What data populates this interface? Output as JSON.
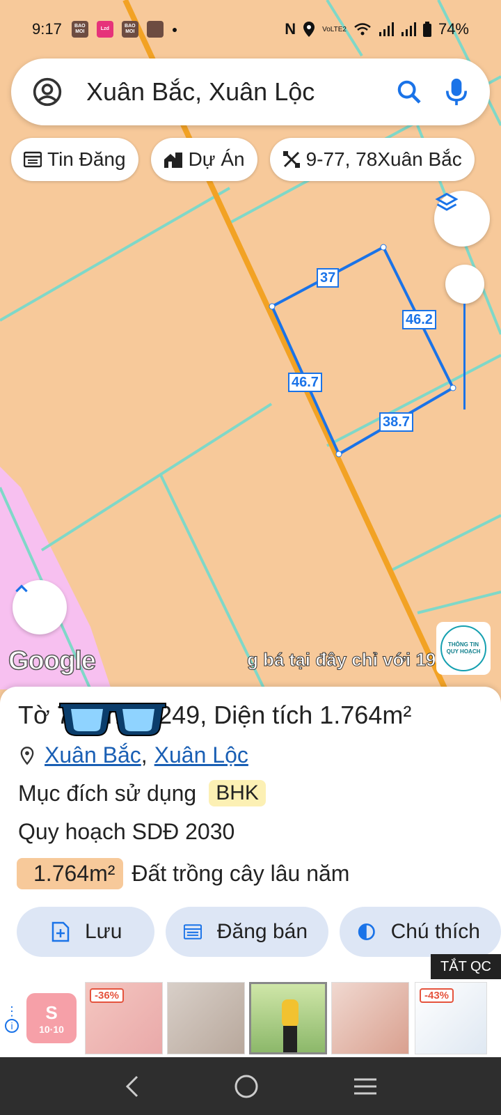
{
  "status_bar": {
    "time": "9:17",
    "apps": [
      "BAO MOI",
      "Lzd",
      "BAO MOI",
      "bag"
    ],
    "network_label": "VoLTE2",
    "battery": "74%"
  },
  "search": {
    "query": "Xuân Bắc, Xuân Lộc"
  },
  "chips": [
    {
      "label": "Tin Đăng",
      "icon": "listing-icon"
    },
    {
      "label": "Dự Án",
      "icon": "building-icon"
    },
    {
      "label": "9-77, 78Xuân Bắc",
      "icon": "parcel-icon"
    }
  ],
  "map": {
    "dimensions": {
      "top": "37",
      "right": "46.2",
      "left": "46.7",
      "bottom": "38.7"
    },
    "attribution": "Google",
    "ticker": "g bá tại đây chỉ với 19k",
    "info_badge": {
      "line1": "THÔNG TIN",
      "line2": "QUY HOẠCH"
    }
  },
  "parcel": {
    "title": "Tờ 79 Thửa 249, Diện tích 1.764m²",
    "location": {
      "commune": "Xuân Bắc",
      "district": "Xuân Lộc",
      "separator": ","
    },
    "purpose_label": "Mục đích sử dụng",
    "purpose_code": "BHK",
    "plan_label": "Quy hoạch SDĐ 2030",
    "area_value": "1.764m²",
    "area_type": "Đất trồng cây lâu năm"
  },
  "actions": [
    {
      "label": "Lưu",
      "icon": "save-icon"
    },
    {
      "label": "Đăng bán",
      "icon": "post-icon"
    },
    {
      "label": "Chú thích",
      "icon": "legend-icon"
    }
  ],
  "ad": {
    "close_label": "TẮT QC",
    "logo_text": "10·10",
    "discounts": [
      "-36%",
      "-43%"
    ]
  },
  "colors": {
    "map_land": "#f7c99a",
    "parcel_line": "#1a73e8",
    "road": "#f2a224",
    "boundary": "#7fd8c8",
    "pink_zone": "#f7c0f0"
  }
}
